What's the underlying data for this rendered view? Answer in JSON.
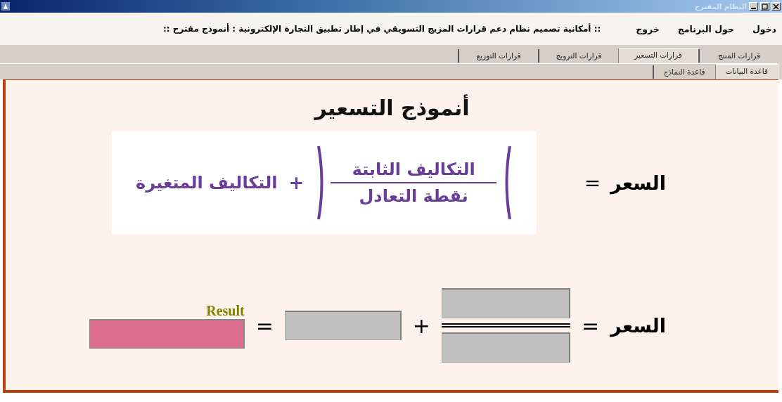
{
  "window": {
    "title": "النظام المقترح"
  },
  "menu": [
    "دخول",
    "حول البرنامج",
    "خروج"
  ],
  "banner": ":: أمكانية تصميم نظام دعم قرارات المزيج التسويقي في إطار تطبيق التجارة الإلكترونية  : أنموذج مقترح ::",
  "tabs": [
    {
      "label": "قرارات المنتج",
      "selected": false
    },
    {
      "label": "قرارات التسعير",
      "selected": true
    },
    {
      "label": "قرارات الترويج",
      "selected": false
    },
    {
      "label": "قرارات التوزيع",
      "selected": false
    }
  ],
  "subtabs": [
    {
      "label": "قاعدة البيانات",
      "selected": true
    },
    {
      "label": "قاعدة النماذج",
      "selected": false
    }
  ],
  "heading": "أنموذج التسعير",
  "formula": {
    "lhs": "السعر",
    "equals": "=",
    "numerator": "التكاليف الثابتة",
    "denominator": "نقطة التعادل",
    "plus": "+",
    "addend": "التكاليف المتغيرة"
  },
  "calculator": {
    "lhs": "السعر",
    "equals": "=",
    "plus": "+",
    "equals_2": "=",
    "result_label": "Result"
  }
}
